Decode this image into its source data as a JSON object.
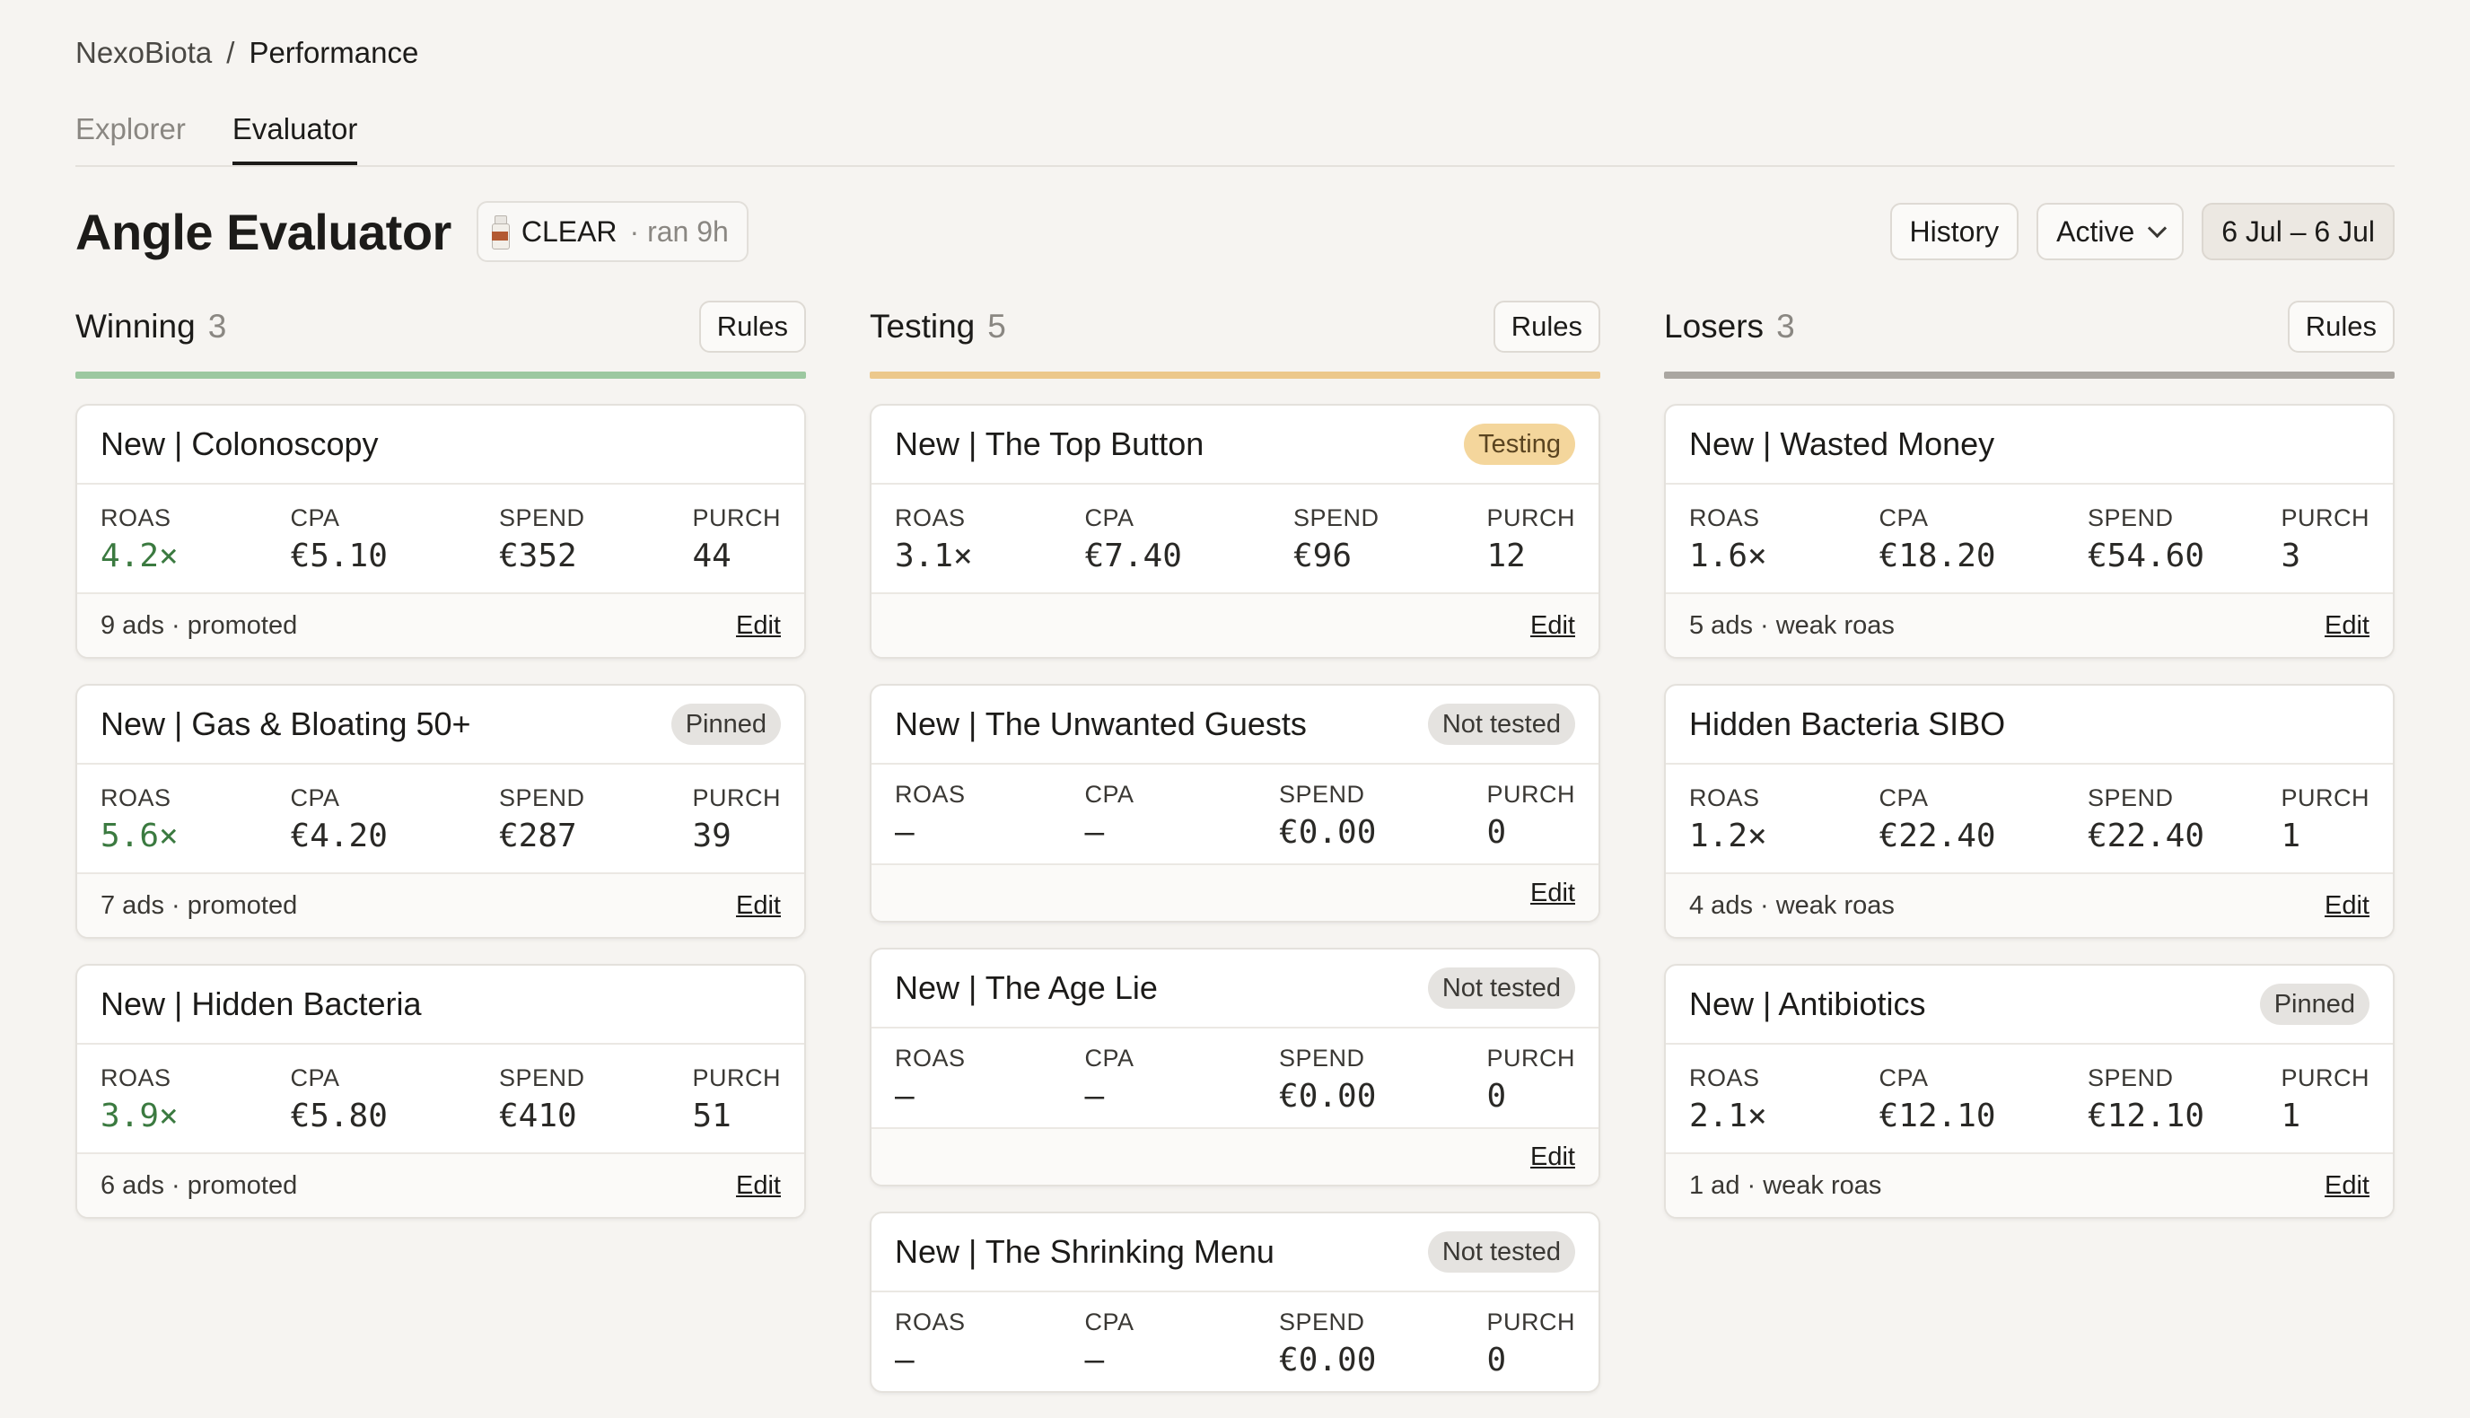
{
  "breadcrumb": {
    "root": "NexoBiota",
    "sep": "/",
    "current": "Performance"
  },
  "tabs": [
    {
      "label": "Explorer"
    },
    {
      "label": "Evaluator"
    }
  ],
  "header": {
    "title": "Angle Evaluator",
    "status_name": "CLEAR",
    "status_meta": "· ran 9h",
    "history_label": "History",
    "filter_label": "Active",
    "date_label": "6 Jul – 6 Jul"
  },
  "colors": {
    "winning": "#9cc8a0",
    "testing": "#ecc88c",
    "losers": "#aaa6a1",
    "good": "#3b7a40"
  },
  "metric_labels": {
    "roas": "ROAS",
    "cpa": "CPA",
    "spend": "SPEND",
    "purch": "PURCH"
  },
  "edit_label": "Edit",
  "columns": [
    {
      "title": "Winning",
      "count": "3",
      "rules_label": "Rules",
      "cards": [
        {
          "title": "New | Colonoscopy",
          "badge": "",
          "roas": "4.2×",
          "cpa": "€5.10",
          "spend": "€352",
          "purch": "44",
          "footer": "9 ads · promoted"
        },
        {
          "title": "New | Gas & Bloating 50+",
          "badge": "Pinned",
          "roas": "5.6×",
          "cpa": "€4.20",
          "spend": "€287",
          "purch": "39",
          "footer": "7 ads · promoted"
        },
        {
          "title": "New | Hidden Bacteria",
          "badge": "",
          "roas": "3.9×",
          "cpa": "€5.80",
          "spend": "€410",
          "purch": "51",
          "footer": "6 ads · promoted"
        }
      ]
    },
    {
      "title": "Testing",
      "count": "5",
      "rules_label": "Rules",
      "cards": [
        {
          "title": "New | The Top Button",
          "badge": "Testing",
          "roas": "3.1×",
          "cpa": "€7.40",
          "spend": "€96",
          "purch": "12",
          "footer": ""
        },
        {
          "title": "New | The Unwanted Guests",
          "badge": "Not tested",
          "roas": "–",
          "cpa": "–",
          "spend": "€0.00",
          "purch": "0",
          "footer": ""
        },
        {
          "title": "New | The Age Lie",
          "badge": "Not tested",
          "roas": "–",
          "cpa": "–",
          "spend": "€0.00",
          "purch": "0",
          "footer": ""
        },
        {
          "title": "New | The Shrinking Menu",
          "badge": "Not tested",
          "roas": "–",
          "cpa": "–",
          "spend": "€0.00",
          "purch": "0",
          "footer": ""
        }
      ]
    },
    {
      "title": "Losers",
      "count": "3",
      "rules_label": "Rules",
      "cards": [
        {
          "title": "New | Wasted Money",
          "badge": "",
          "roas": "1.6×",
          "cpa": "€18.20",
          "spend": "€54.60",
          "purch": "3",
          "footer": "5 ads · weak roas"
        },
        {
          "title": "Hidden Bacteria SIBO",
          "badge": "",
          "roas": "1.2×",
          "cpa": "€22.40",
          "spend": "€22.40",
          "purch": "1",
          "footer": "4 ads · weak roas"
        },
        {
          "title": "New | Antibiotics",
          "badge": "Pinned",
          "roas": "2.1×",
          "cpa": "€12.10",
          "spend": "€12.10",
          "purch": "1",
          "footer": "1 ad · weak roas"
        }
      ]
    }
  ]
}
